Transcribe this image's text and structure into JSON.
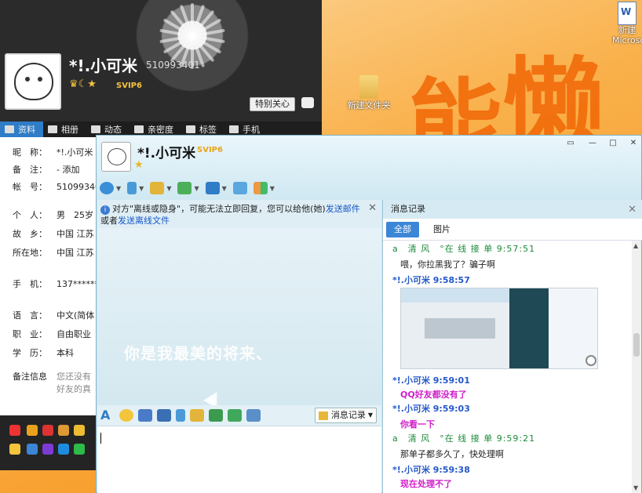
{
  "desktop": {
    "big_text": [
      "能",
      "懒"
    ],
    "doc_icon_label": [
      "新建",
      "Microso"
    ],
    "folder_icon_label": "新建文件夹"
  },
  "profile": {
    "name": "*!.小可米",
    "qq_number": "510993401",
    "svip_label": "SVIP6",
    "special_care_button": "特别关心",
    "tabs": [
      {
        "label": "资料",
        "icon": "profile-card-icon"
      },
      {
        "label": "相册",
        "icon": "photo-icon"
      },
      {
        "label": "动态",
        "icon": "feed-icon"
      },
      {
        "label": "亲密度",
        "icon": "heart-icon"
      },
      {
        "label": "标签",
        "icon": "tag-icon"
      },
      {
        "label": "手机",
        "icon": "phone-icon"
      }
    ],
    "fields": [
      {
        "key": "昵　称：",
        "value": "*!.小可米"
      },
      {
        "key": "备　注：",
        "value": "- 添加"
      },
      {
        "key": "帐　号：",
        "value": "51099340"
      },
      {
        "key": "个　人：",
        "value": "男　25岁"
      },
      {
        "key": "故　乡：",
        "value": "中国 江苏"
      },
      {
        "key": "所在地：",
        "value": "中国 江苏"
      },
      {
        "key": "手　机：",
        "value": "137******"
      },
      {
        "key": "语　言：",
        "value": "中文(简体"
      },
      {
        "key": "职　业：",
        "value": "自由职业"
      },
      {
        "key": "学　历：",
        "value": "本科"
      },
      {
        "key": "备注信息",
        "value": "您还没有"
      },
      {
        "key": "",
        "value": "好友的真"
      }
    ]
  },
  "chat": {
    "contact_name": "*!.小可米",
    "svip_label": "SVIP6",
    "window_controls": [
      "▭",
      "—",
      "□",
      "✕"
    ],
    "toolbar_icons": [
      "video-call-icon",
      "voice-call-icon",
      "file-transfer-icon",
      "add-app-icon",
      "remote-desktop-icon",
      "screen-share-icon",
      "apps-grid-icon"
    ],
    "notice": {
      "text_prefix": "对方\"离线或隐身\"，可能无法立即回复，您可以给他(她)",
      "link_email": "发送邮件",
      "text_mid": "或者",
      "link_offline_file": "发送离线文件"
    },
    "watermark": "你是我最美的将来、",
    "input_toolbar_icons": [
      "font-icon",
      "emoji-icon",
      "shake-icon",
      "screen-capture-icon",
      "voice-message-icon",
      "scribble-icon",
      "image-icon",
      "music-icon",
      "screenshot-icon"
    ],
    "history_button": "消息记录"
  },
  "history": {
    "title": "消息记录",
    "tabs": [
      "全部",
      "图片"
    ],
    "messages": [
      {
        "sender": "a　清 风　°在 线 接 单 9:57:51",
        "who": "them",
        "text": "喂，你拉黑我了？骗子啊"
      },
      {
        "sender": "*!.小可米 9:58:57",
        "who": "me",
        "text": "",
        "has_image": true
      },
      {
        "sender": "*!.小可米 9:59:01",
        "who": "me",
        "text": "QQ好友都没有了"
      },
      {
        "sender": "*!.小可米 9:59:03",
        "who": "me",
        "text": "你看一下"
      },
      {
        "sender": "a　清 风　°在 线 接 单 9:59:21",
        "who": "them",
        "text": "那单子都多久了，快处理啊"
      },
      {
        "sender": "*!.小可米 9:59:38",
        "who": "me",
        "text": "现在处理不了"
      }
    ]
  }
}
